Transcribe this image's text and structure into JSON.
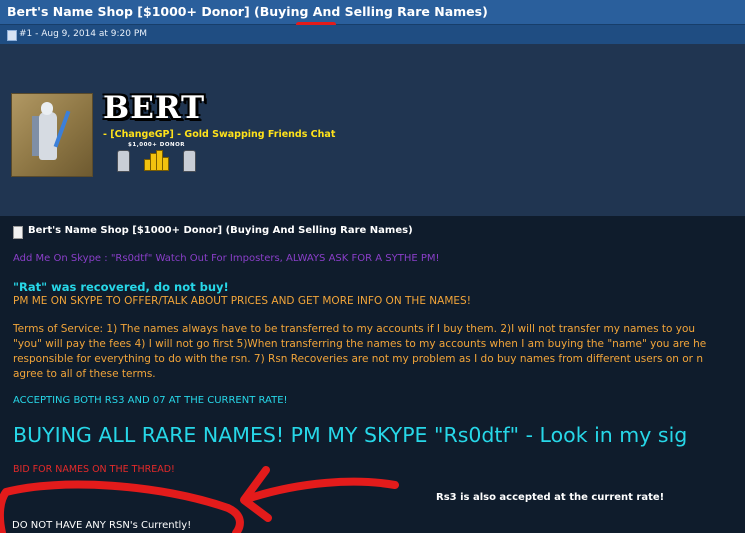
{
  "thread": {
    "title": "Bert's Name Shop [$1000+ Donor] (Buying And Selling Rare Names)"
  },
  "post": {
    "meta": "#1 - Aug 9, 2014 at 9:20 PM",
    "user": {
      "name": "BERT",
      "clan_prefix": "- ",
      "clan": "[ChangeGP]",
      "clan_suffix": " - Gold Swapping Friends Chat",
      "donor_label": "$1,000+ DONOR"
    },
    "title": "Bert's Name Shop [$1000+ Donor] (Buying And Selling Rare Names)",
    "skype_notice": "Add Me On Skype : \"Rs0dtf\" Watch Out For Imposters, ALWAYS ASK FOR A SYTHE PM!",
    "rat_notice": "\"Rat\" was recovered, do not buy!",
    "pm_notice": "PM ME ON SKYPE TO OFFER/TALK ABOUT PRICES AND GET MORE INFO ON THE NAMES!",
    "tos_lines": [
      "Terms of Service: 1) The names always have to be transferred to my accounts if I buy them. 2)I will not transfer my names to you",
      "\"you\" will pay the fees 4) I will not go first 5)When transferring the names to my accounts when I am buying the \"name\" you are he",
      "responsible for everything to do with the rsn. 7) Rsn Recoveries are not my problem as I do buy names from different users on or n",
      "agree to all of these terms."
    ],
    "accepting": "ACCEPTING BOTH RS3 AND 07 AT THE CURRENT RATE!",
    "buying_banner": "BUYING ALL RARE NAMES! PM MY SKYPE \"Rs0dtf\" - Look in my sig",
    "bid_notice": "BID FOR NAMES ON THE THREAD!",
    "rs3_notice": "Rs3 is also accepted at the current rate!",
    "no_rsn": "DO NOT HAVE ANY RSN's Currently!"
  },
  "icons": {
    "post_link": "post-link-icon",
    "post_title": "document-icon",
    "donor_badge": "robe-icon",
    "gold": "gold-coins-icon"
  },
  "colors": {
    "title_bar": "#2a5f9c",
    "purple_text": "#8a3fc9",
    "cyan_text": "#27d7e8",
    "orange_text": "#f2a53a",
    "red_text": "#e42a2a",
    "annotation_red": "#e31b1b"
  }
}
